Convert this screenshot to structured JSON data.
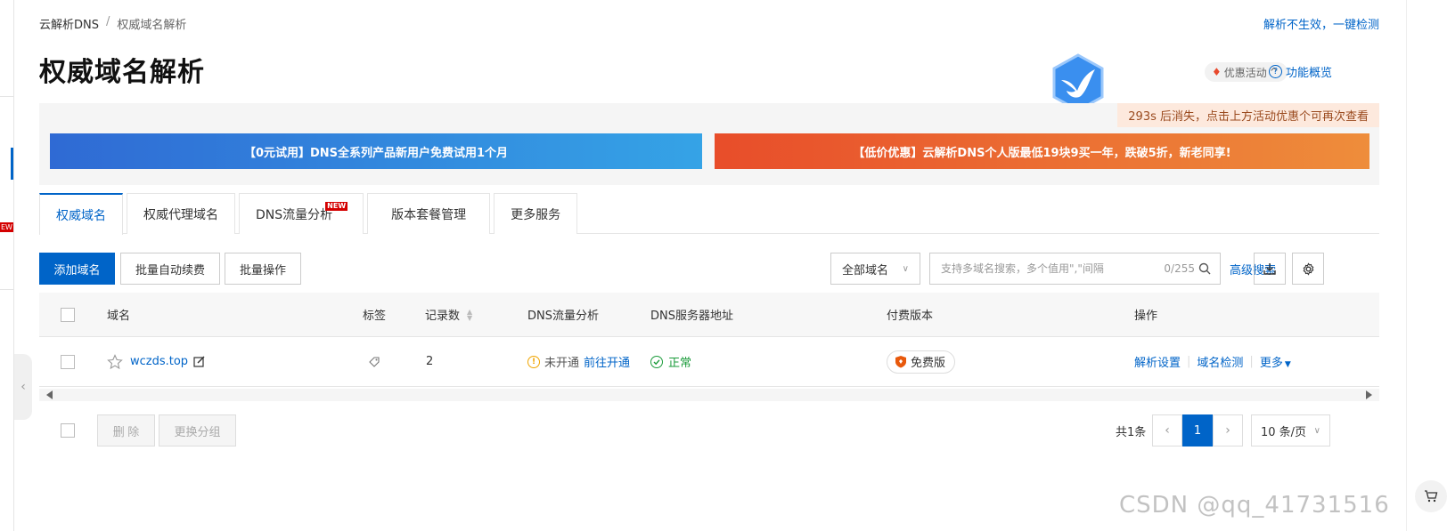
{
  "breadcrumb": {
    "root": "云解析DNS",
    "separator": "/",
    "current": "权威域名解析"
  },
  "header": {
    "check_link": "解析不生效，一键检测",
    "title": "权威域名解析",
    "promo_label": "优惠活动",
    "promo_chevron": "^",
    "overview_label": "功能概览",
    "overview_icon_text": "?"
  },
  "banners": {
    "countdown": "293s 后消失，点击上方活动优惠个可再次查看",
    "left": "【0元试用】DNS全系列产品新用户免费试用1个月",
    "right": "【低价优惠】云解析DNS个人版最低19块9买一年，跌破5折，新老同享!"
  },
  "tabs": [
    {
      "label": "权威域名",
      "active": true
    },
    {
      "label": "权威代理域名"
    },
    {
      "label": "DNS流量分析",
      "badge": "NEW"
    },
    {
      "label": "版本套餐管理"
    },
    {
      "label": "更多服务"
    }
  ],
  "toolbar": {
    "add_domain": "添加域名",
    "batch_renew": "批量自动续费",
    "batch_ops": "批量操作",
    "domain_filter": "全部域名",
    "search_placeholder": "支持多域名搜索，多个值用\",\"间隔",
    "search_counter": "0/255",
    "advanced_search": "高级搜索"
  },
  "table": {
    "headers": {
      "domain": "域名",
      "tag": "标签",
      "records": "记录数",
      "dns_analysis": "DNS流量分析",
      "dns_servers": "DNS服务器地址",
      "edition": "付费版本",
      "actions": "操作"
    },
    "rows": [
      {
        "domain": "wczds.top",
        "records": "2",
        "analysis_status": "未开通",
        "analysis_link": "前往开通",
        "server_status": "正常",
        "edition": "免费版",
        "action_resolve": "解析设置",
        "action_check": "域名检测",
        "action_more": "更多"
      }
    ]
  },
  "footer": {
    "delete": "删 除",
    "change_group": "更换分组",
    "total": "共1条",
    "current_page": "1",
    "page_size": "10 条/页"
  },
  "sidebar": {
    "new_badge": "EW"
  },
  "watermark": "CSDN @qq_41731516",
  "colors": {
    "primary": "#0064c8",
    "warning": "#f0a500",
    "success": "#1a9b3a",
    "orange": "#e84d2a"
  }
}
